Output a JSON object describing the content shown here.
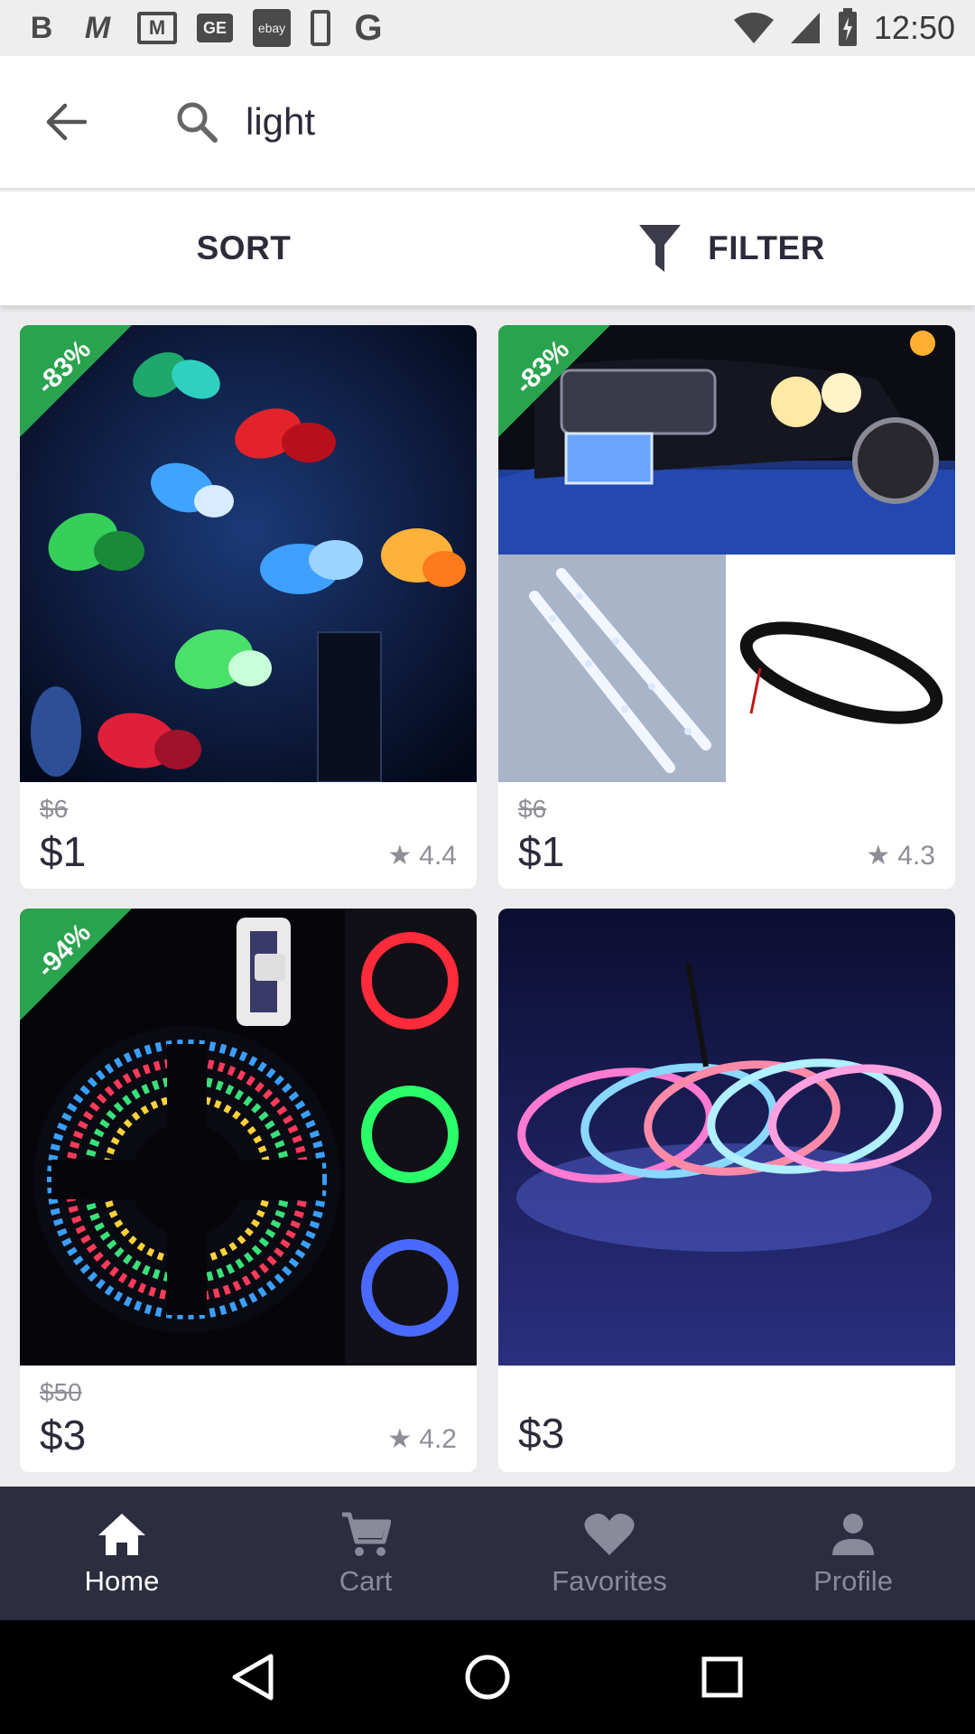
{
  "status_bar": {
    "time": "12:50",
    "notification_icons": [
      "b-app-icon",
      "m-app-icon",
      "gmail-icon",
      "ge-app-icon",
      "ebay-app-icon",
      "phone-icon",
      "google-icon"
    ],
    "ebay_label": "ebay",
    "ge_label": "GE"
  },
  "search": {
    "query": "light"
  },
  "toolbar": {
    "sort_label": "SORT",
    "filter_label": "FILTER"
  },
  "products": [
    {
      "badge": "-83%",
      "old_price": "$6",
      "price": "$1",
      "rating": "4.4",
      "image": "butterfly-led-lights"
    },
    {
      "badge": "-83%",
      "old_price": "$6",
      "price": "$1",
      "rating": "4.3",
      "image": "car-led-strip"
    },
    {
      "badge": "-94%",
      "old_price": "$50",
      "price": "$3",
      "rating": "4.2",
      "image": "rgb-led-strip-reel"
    },
    {
      "badge": "",
      "old_price": "",
      "price": "$3",
      "rating": "",
      "image": "rgb-led-strip-coils"
    }
  ],
  "bottom_nav": {
    "items": [
      {
        "label": "Home",
        "active": true
      },
      {
        "label": "Cart",
        "active": false
      },
      {
        "label": "Favorites",
        "active": false
      },
      {
        "label": "Profile",
        "active": false
      }
    ]
  },
  "colors": {
    "badge_green": "#2aa34f",
    "nav_bg": "#2d2d40",
    "text_dark": "#2b2b3a"
  }
}
